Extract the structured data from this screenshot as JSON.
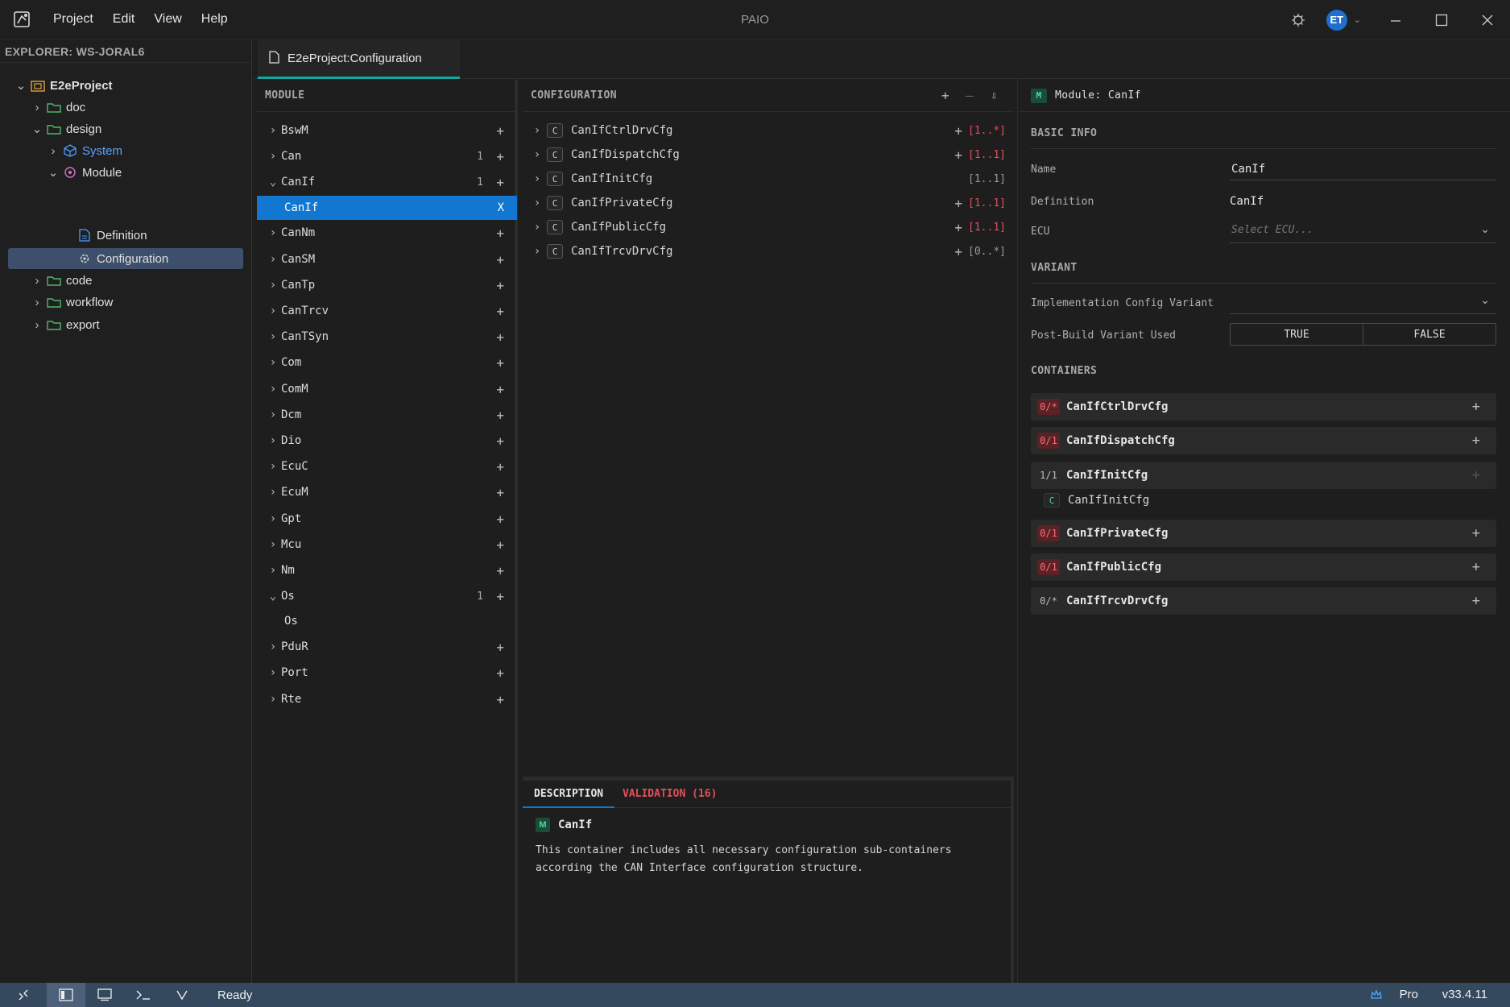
{
  "app": {
    "title": "PAIO"
  },
  "menu": [
    "Project",
    "Edit",
    "View",
    "Help"
  ],
  "user": {
    "initials": "ET"
  },
  "explorer": {
    "title": "EXPLORER: WS-JORAL6",
    "items": [
      {
        "label": "E2eProject"
      },
      {
        "label": "doc"
      },
      {
        "label": "design"
      },
      {
        "label": "System"
      },
      {
        "label": "Module"
      },
      {
        "label": "Definition"
      },
      {
        "label": "Configuration"
      },
      {
        "label": "code"
      },
      {
        "label": "workflow"
      },
      {
        "label": "export"
      }
    ]
  },
  "tab": {
    "label": "E2eProject:Configuration"
  },
  "module_panel": {
    "title": "MODULE",
    "items": [
      {
        "label": "BswM",
        "count": ""
      },
      {
        "label": "Can",
        "count": "1"
      },
      {
        "label": "CanIf",
        "count": "1"
      },
      {
        "label": "CanIf",
        "count": ""
      },
      {
        "label": "CanNm",
        "count": ""
      },
      {
        "label": "CanSM",
        "count": ""
      },
      {
        "label": "CanTp",
        "count": ""
      },
      {
        "label": "CanTrcv",
        "count": ""
      },
      {
        "label": "CanTSyn",
        "count": ""
      },
      {
        "label": "Com",
        "count": ""
      },
      {
        "label": "ComM",
        "count": ""
      },
      {
        "label": "Dcm",
        "count": ""
      },
      {
        "label": "Dio",
        "count": ""
      },
      {
        "label": "EcuC",
        "count": ""
      },
      {
        "label": "EcuM",
        "count": ""
      },
      {
        "label": "Gpt",
        "count": ""
      },
      {
        "label": "Mcu",
        "count": ""
      },
      {
        "label": "Nm",
        "count": ""
      },
      {
        "label": "Os",
        "count": "1"
      },
      {
        "label": "Os",
        "count": ""
      },
      {
        "label": "PduR",
        "count": ""
      },
      {
        "label": "Port",
        "count": ""
      },
      {
        "label": "Rte",
        "count": ""
      }
    ],
    "remove_label": "X",
    "plus_label": "+"
  },
  "config_panel": {
    "title": "CONFIGURATION",
    "badge": "C",
    "items": [
      {
        "label": "CanIfCtrlDrvCfg",
        "mult": "[1..*]"
      },
      {
        "label": "CanIfDispatchCfg",
        "mult": "[1..1]"
      },
      {
        "label": "CanIfInitCfg",
        "mult": "[1..1]"
      },
      {
        "label": "CanIfPrivateCfg",
        "mult": "[1..1]"
      },
      {
        "label": "CanIfPublicCfg",
        "mult": "[1..1]"
      },
      {
        "label": "CanIfTrcvDrvCfg",
        "mult": "[0..*]"
      }
    ]
  },
  "bottom_panel": {
    "tabs": {
      "description": "DESCRIPTION",
      "validation": "VALIDATION (16)"
    },
    "badge": "M",
    "name": "CanIf",
    "text": "This container includes all necessary configuration sub-containers according the CAN Interface configuration structure."
  },
  "props": {
    "badge": "M",
    "header": "Module: CanIf",
    "basic_info": "BASIC INFO",
    "name_label": "Name",
    "name_value": "CanIf",
    "definition_label": "Definition",
    "definition_value": "CanIf",
    "ecu_label": "ECU",
    "ecu_placeholder": "Select ECU...",
    "variant": "VARIANT",
    "impl_label": "Implementation Config Variant",
    "postbuild_label": "Post-Build Variant Used",
    "true_label": "TRUE",
    "false_label": "FALSE",
    "containers": "CONTAINERS",
    "container_items": [
      {
        "badge": "0/*",
        "label": "CanIfCtrlDrvCfg"
      },
      {
        "badge": "0/1",
        "label": "CanIfDispatchCfg"
      },
      {
        "badge": "1/1",
        "label": "CanIfInitCfg"
      },
      {
        "badge": "0/1",
        "label": "CanIfPrivateCfg"
      },
      {
        "badge": "0/1",
        "label": "CanIfPublicCfg"
      },
      {
        "badge": "0/*",
        "label": "CanIfTrcvDrvCfg"
      }
    ],
    "sub_badge": "C",
    "sub_label": "CanIfInitCfg"
  },
  "status": {
    "text": "Ready",
    "plan": "Pro",
    "version": "v33.4.11"
  },
  "colors": {
    "accent": "#14a7a0",
    "selection": "#1177d1",
    "error": "#e0505a",
    "statusbar": "#34495e"
  }
}
